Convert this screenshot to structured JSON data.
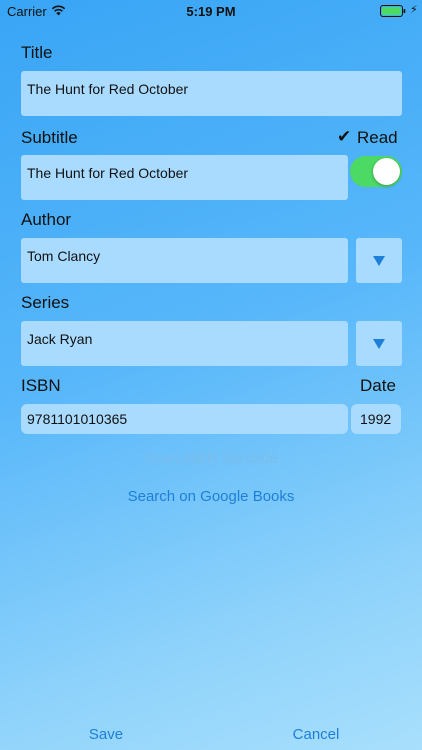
{
  "status_bar": {
    "carrier": "Carrier",
    "time": "5:19 PM"
  },
  "form": {
    "title_label": "Title",
    "title_value": "The Hunt for Red October",
    "subtitle_label": "Subtitle",
    "subtitle_value": "The Hunt for Red October",
    "read_label": "Read",
    "read_checkmark": "✔",
    "read_toggle_on": true,
    "author_label": "Author",
    "author_value": "Tom Clancy",
    "series_label": "Series",
    "series_value": "Jack Ryan",
    "isbn_label": "ISBN",
    "isbn_value": "9781101010365",
    "date_label": "Date",
    "date_value": "1992"
  },
  "actions": {
    "scan_isbn": "Scan ISBN Barcode",
    "search_google": "Search on Google Books",
    "save": "Save",
    "cancel": "Cancel"
  },
  "colors": {
    "accent": "#1e7fd9",
    "disabled": "#7cbcea",
    "field_bg": "#a8dbff",
    "toggle_on": "#4cd964",
    "battery": "#4cd964"
  },
  "icons": {
    "dropdown": "chevron-down-icon",
    "wifi": "wifi-icon",
    "battery": "battery-icon",
    "charging": "bolt-icon"
  }
}
